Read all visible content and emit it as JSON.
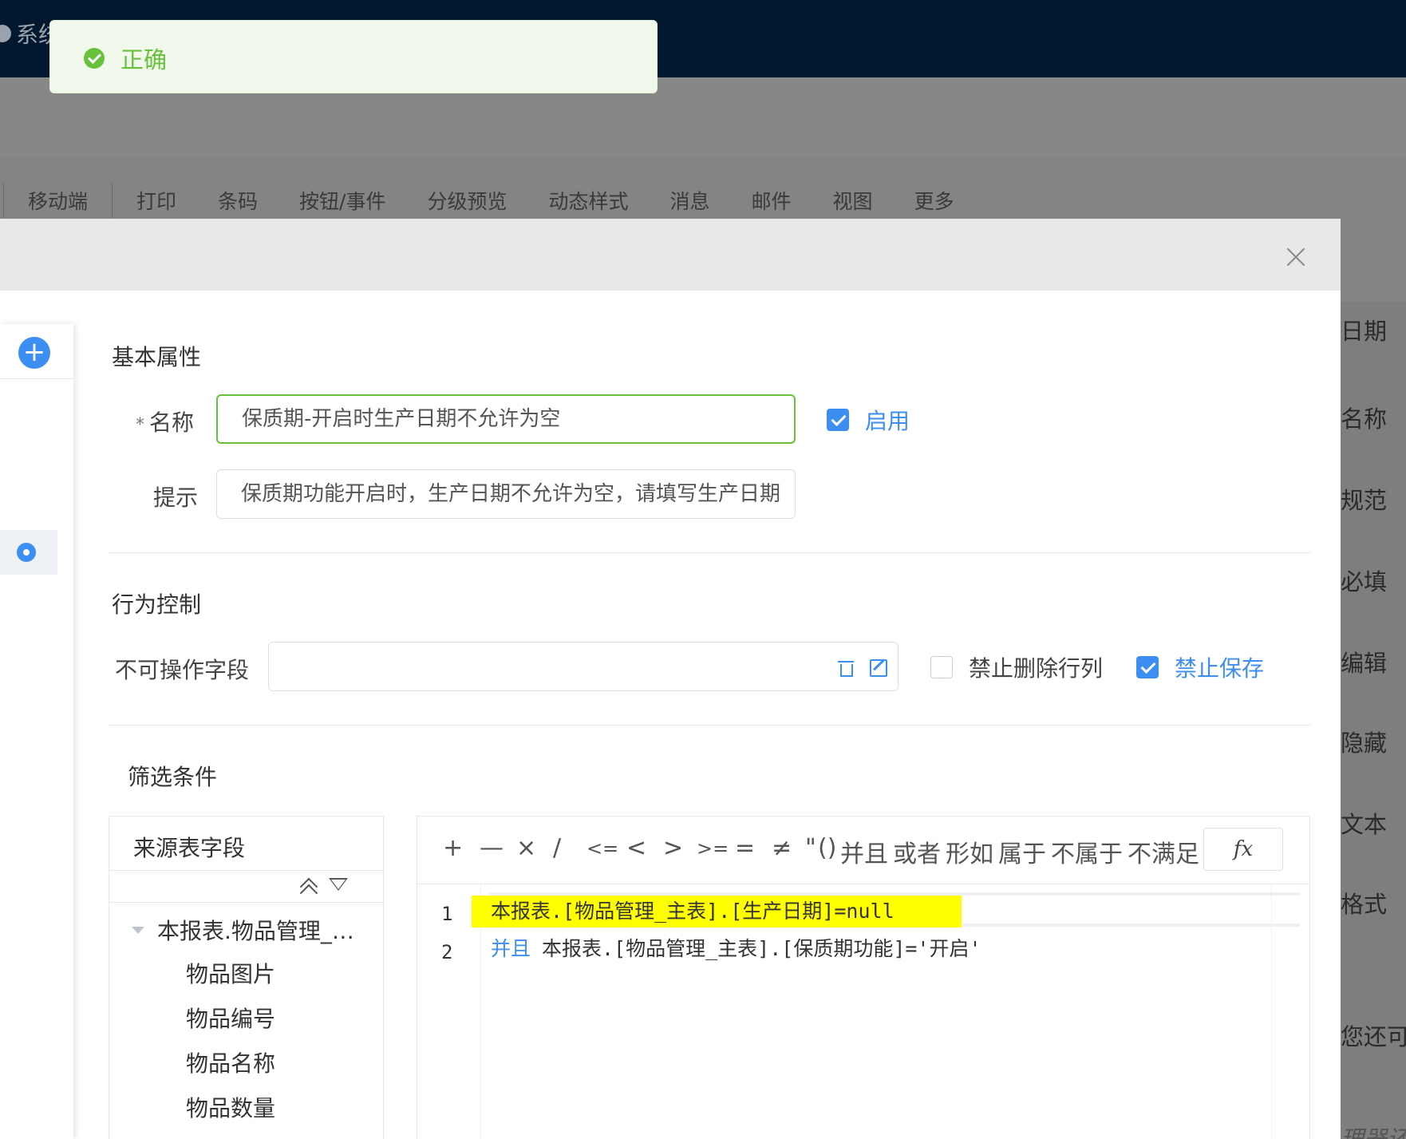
{
  "background": {
    "app_title": "系统",
    "tabs": [
      "移动端",
      "打印",
      "条码",
      "按钮/事件",
      "分级预览",
      "动态样式",
      "消息",
      "邮件",
      "视图",
      "更多"
    ],
    "right_panel": [
      "日期",
      "名称",
      "规范",
      "必填",
      "编辑",
      "隐藏",
      "文本",
      "格式",
      "您还可以",
      "理器还需"
    ]
  },
  "toast": {
    "message": "正确"
  },
  "basic": {
    "section_title": "基本属性",
    "name_label": "名称",
    "name_value": "保质期-开启时生产日期不允许为空",
    "enable_label": "启用",
    "hint_label": "提示",
    "hint_value": "保质期功能开启时，生产日期不允许为空，请填写生产日期"
  },
  "behavior": {
    "section_title": "行为控制",
    "readonly_fields_label": "不可操作字段",
    "readonly_fields_value": "",
    "no_delete_label": "禁止删除行列",
    "no_save_label": "禁止保存"
  },
  "filter": {
    "section_title": "筛选条件",
    "source_title": "来源表字段",
    "tree_root": "本报表.物品管理_…",
    "tree_children": [
      "物品图片",
      "物品编号",
      "物品名称",
      "物品数量"
    ],
    "operators": [
      "+",
      "—",
      "×",
      "∕",
      "<=",
      "<",
      ">",
      ">=",
      "=",
      "≠",
      "\"",
      "()",
      "并且",
      "或者",
      "形如",
      "属于",
      "不属于",
      "不满足"
    ],
    "fx_label": "fx",
    "lines": [
      {
        "num": "1",
        "keyword": "",
        "code": "本报表.[物品管理_主表].[生产日期]=null"
      },
      {
        "num": "2",
        "keyword": "并且",
        "code": "本报表.[物品管理_主表].[保质期功能]='开启'"
      }
    ]
  },
  "colors": {
    "accent": "#3d8ef2",
    "success": "#67c23a",
    "highlight": "#ffff00",
    "topbar": "#02182f"
  }
}
